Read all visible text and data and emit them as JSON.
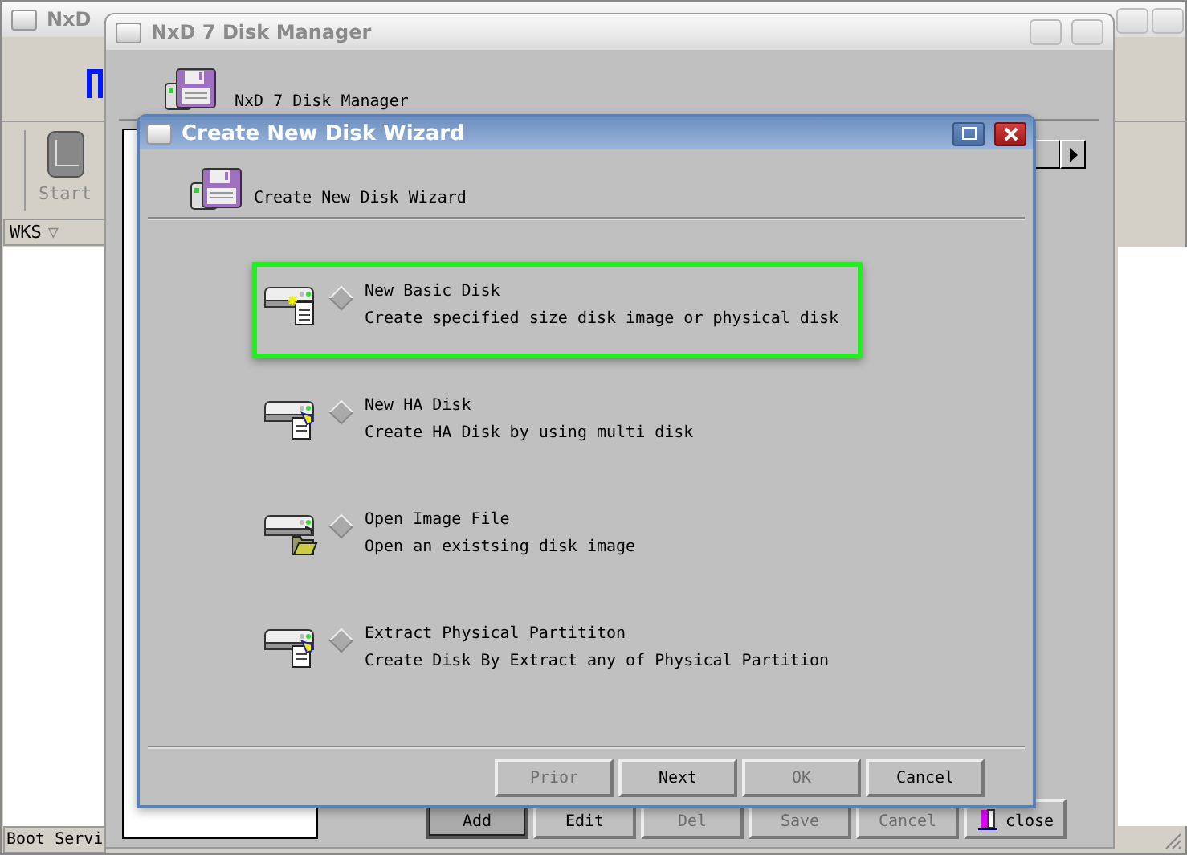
{
  "back_window": {
    "title": "NxD",
    "toolbar": [
      {
        "label": "Start"
      }
    ],
    "list_header": "WKS",
    "list_header_glyph": "▽",
    "status": "Boot Servi"
  },
  "manager_window": {
    "title": "NxD 7 Disk Manager",
    "header": "NxD 7 Disk Manager",
    "buttons": [
      {
        "label": "Add",
        "disabled": false,
        "pressed": true
      },
      {
        "label": "Edit",
        "disabled": false,
        "pressed": false
      },
      {
        "label": "Del",
        "disabled": true,
        "pressed": false
      },
      {
        "label": "Save",
        "disabled": true,
        "pressed": false
      },
      {
        "label": "Cancel",
        "disabled": true,
        "pressed": false
      },
      {
        "label": "close",
        "disabled": false,
        "pressed": false
      }
    ]
  },
  "wizard": {
    "title": "Create New Disk Wizard",
    "header": "Create New Disk Wizard",
    "options": [
      {
        "title": "New Basic Disk",
        "description": "Create specified size disk image or physical disk",
        "selected": true,
        "checked": false
      },
      {
        "title": "New HA Disk",
        "description": "Create HA Disk by using multi disk",
        "selected": false,
        "checked": false
      },
      {
        "title": "Open Image File",
        "description": "Open an existsing disk image",
        "selected": false,
        "checked": false
      },
      {
        "title": "Extract Physical Partititon",
        "description": "Create Disk By Extract any of Physical Partition",
        "selected": false,
        "checked": false
      }
    ],
    "buttons": [
      {
        "label": "Prior",
        "disabled": true
      },
      {
        "label": "Next",
        "disabled": false
      },
      {
        "label": "OK",
        "disabled": true
      },
      {
        "label": "Cancel",
        "disabled": false
      }
    ]
  }
}
